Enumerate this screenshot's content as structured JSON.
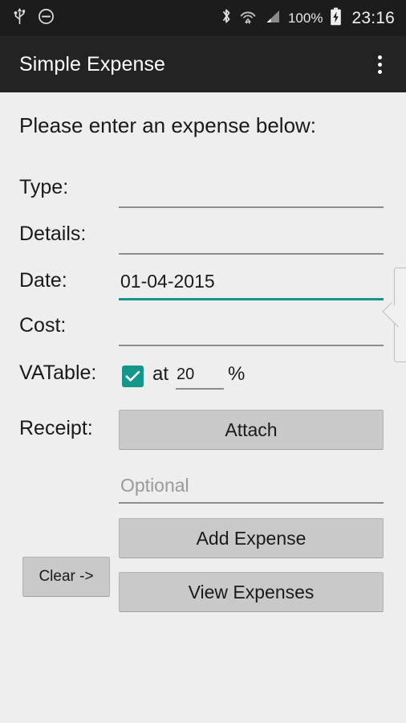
{
  "status_bar": {
    "usb_icon": "usb-icon",
    "dnd_icon": "do-not-disturb-icon",
    "bluetooth_icon": "bluetooth-icon",
    "wifi_icon": "wifi-icon",
    "signal_icon": "cellular-signal-icon",
    "battery_percent": "100%",
    "battery_icon": "battery-charging-icon",
    "clock": "23:16",
    "background_color": "#1c1c1c"
  },
  "app_bar": {
    "title": "Simple Expense",
    "overflow_icon": "overflow-menu-icon",
    "background_color": "#232323"
  },
  "form": {
    "heading": "Please enter an expense below:",
    "accent_color": "#14968a",
    "background_color": "#eeeeee",
    "fields": {
      "type": {
        "label": "Type:",
        "value": "",
        "placeholder": ""
      },
      "details": {
        "label": "Details:",
        "value": "",
        "placeholder": ""
      },
      "date": {
        "label": "Date:",
        "value": "01-04-2015",
        "placeholder": "",
        "focused": true
      },
      "cost": {
        "label": "Cost:",
        "value": "",
        "placeholder": ""
      },
      "vatable": {
        "label": "VATable:",
        "checked": true,
        "at_label": "at",
        "rate_value": "20",
        "percent_label": "%"
      },
      "receipt": {
        "label": "Receipt:"
      },
      "receipt_note": {
        "value": "",
        "placeholder": "Optional"
      }
    },
    "buttons": {
      "attach": "Attach",
      "clear": "Clear ->",
      "add_expense": "Add Expense",
      "view_expenses": "View Expenses"
    }
  }
}
